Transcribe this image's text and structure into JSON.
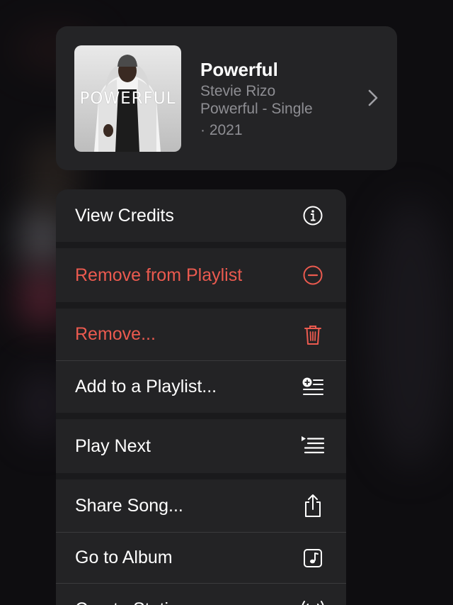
{
  "song": {
    "title": "Powerful",
    "artist": "Stevie Rizo",
    "album": "Powerful - Single",
    "year": "· 2021",
    "artwork_text": "POWERFUL"
  },
  "menu": {
    "items": [
      {
        "label": "View Credits",
        "icon": "info-icon",
        "color": "#ffffff"
      },
      {
        "label": "Remove from Playlist",
        "icon": "minus-circle-icon",
        "color": "#eb5a4f"
      },
      {
        "label": "Remove...",
        "icon": "trash-icon",
        "color": "#eb5a4f"
      },
      {
        "label": "Add to a Playlist...",
        "icon": "add-to-playlist-icon",
        "color": "#ffffff"
      },
      {
        "label": "Play Next",
        "icon": "play-next-icon",
        "color": "#ffffff"
      },
      {
        "label": "Share Song...",
        "icon": "share-icon",
        "color": "#ffffff"
      },
      {
        "label": "Go to Album",
        "icon": "album-icon",
        "color": "#ffffff"
      },
      {
        "label": "Create Station",
        "icon": "station-icon",
        "color": "#ffffff"
      }
    ]
  },
  "colors": {
    "destructive": "#eb5a4f",
    "card_background": "#242426",
    "secondary_text": "#8e8e93"
  }
}
